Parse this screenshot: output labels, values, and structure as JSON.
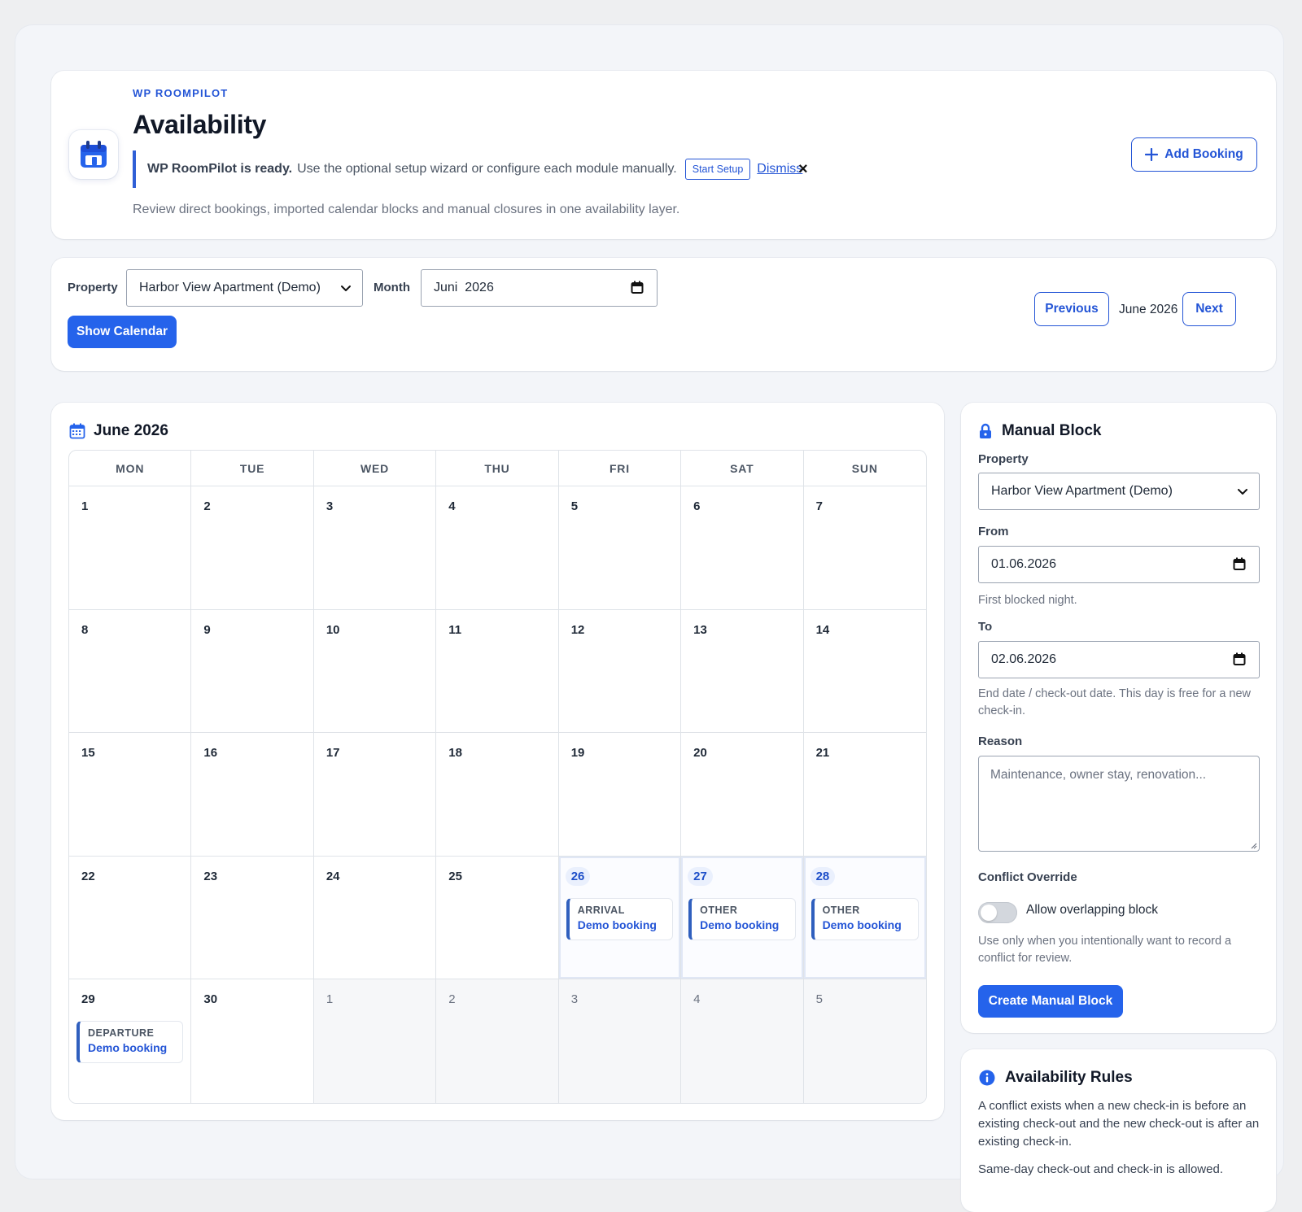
{
  "header": {
    "eyebrow": "WP ROOMPILOT",
    "title": "Availability",
    "notice_strong": "WP RoomPilot is ready.",
    "notice_text": "Use the optional setup wizard or configure each module manually.",
    "start_setup_label": "Start Setup",
    "dismiss_label": "Dismiss",
    "close_glyph": "×",
    "description": "Review direct bookings, imported calendar blocks and manual closures in one availability layer.",
    "add_booking_label": "Add Booking"
  },
  "filters": {
    "property_label": "Property",
    "property_value": "Harbor View Apartment (Demo)",
    "month_label": "Month",
    "month_value": "Juni  2026",
    "show_calendar_label": "Show Calendar",
    "previous_label": "Previous",
    "current_month": "June 2026",
    "next_label": "Next"
  },
  "calendar": {
    "title": "June 2026",
    "weekdays": [
      "MON",
      "TUE",
      "WED",
      "THU",
      "FRI",
      "SAT",
      "SUN"
    ],
    "days": [
      {
        "n": "1"
      },
      {
        "n": "2"
      },
      {
        "n": "3"
      },
      {
        "n": "4"
      },
      {
        "n": "5"
      },
      {
        "n": "6"
      },
      {
        "n": "7"
      },
      {
        "n": "8"
      },
      {
        "n": "9"
      },
      {
        "n": "10"
      },
      {
        "n": "11"
      },
      {
        "n": "12"
      },
      {
        "n": "13"
      },
      {
        "n": "14"
      },
      {
        "n": "15"
      },
      {
        "n": "16"
      },
      {
        "n": "17"
      },
      {
        "n": "18"
      },
      {
        "n": "19"
      },
      {
        "n": "20"
      },
      {
        "n": "21"
      },
      {
        "n": "22"
      },
      {
        "n": "23"
      },
      {
        "n": "24"
      },
      {
        "n": "25"
      },
      {
        "n": "26",
        "booked": true,
        "event": {
          "type": "ARRIVAL",
          "title": "Demo booking"
        }
      },
      {
        "n": "27",
        "booked": true,
        "event": {
          "type": "OTHER",
          "title": "Demo booking"
        }
      },
      {
        "n": "28",
        "booked": true,
        "event": {
          "type": "OTHER",
          "title": "Demo booking"
        }
      },
      {
        "n": "29",
        "event": {
          "type": "DEPARTURE",
          "title": "Demo booking"
        }
      },
      {
        "n": "30"
      },
      {
        "n": "1",
        "outside": true
      },
      {
        "n": "2",
        "outside": true
      },
      {
        "n": "3",
        "outside": true
      },
      {
        "n": "4",
        "outside": true
      },
      {
        "n": "5",
        "outside": true
      }
    ]
  },
  "manual_block": {
    "title": "Manual Block",
    "property_label": "Property",
    "property_value": "Harbor View Apartment (Demo)",
    "from_label": "From",
    "from_value": "01.06.2026",
    "from_help": "First blocked night.",
    "to_label": "To",
    "to_value": "02.06.2026",
    "to_help": "End date / check-out date. This day is free for a new check-in.",
    "reason_label": "Reason",
    "reason_placeholder": "Maintenance, owner stay, renovation...",
    "conflict_label": "Conflict Override",
    "toggle_label": "Allow overlapping block",
    "toggle_on": false,
    "conflict_help": "Use only when you intentionally want to record a conflict for review.",
    "create_label": "Create Manual Block"
  },
  "rules": {
    "title": "Availability Rules",
    "paragraphs": [
      "A conflict exists when a new check-in is before an existing check-out and the new check-out is after an existing check-in.",
      "Same-day check-out and check-in is allowed."
    ]
  },
  "colors": {
    "accent": "#2563eb",
    "link": "#2455d6",
    "event_bar": "#2f5fbe"
  }
}
